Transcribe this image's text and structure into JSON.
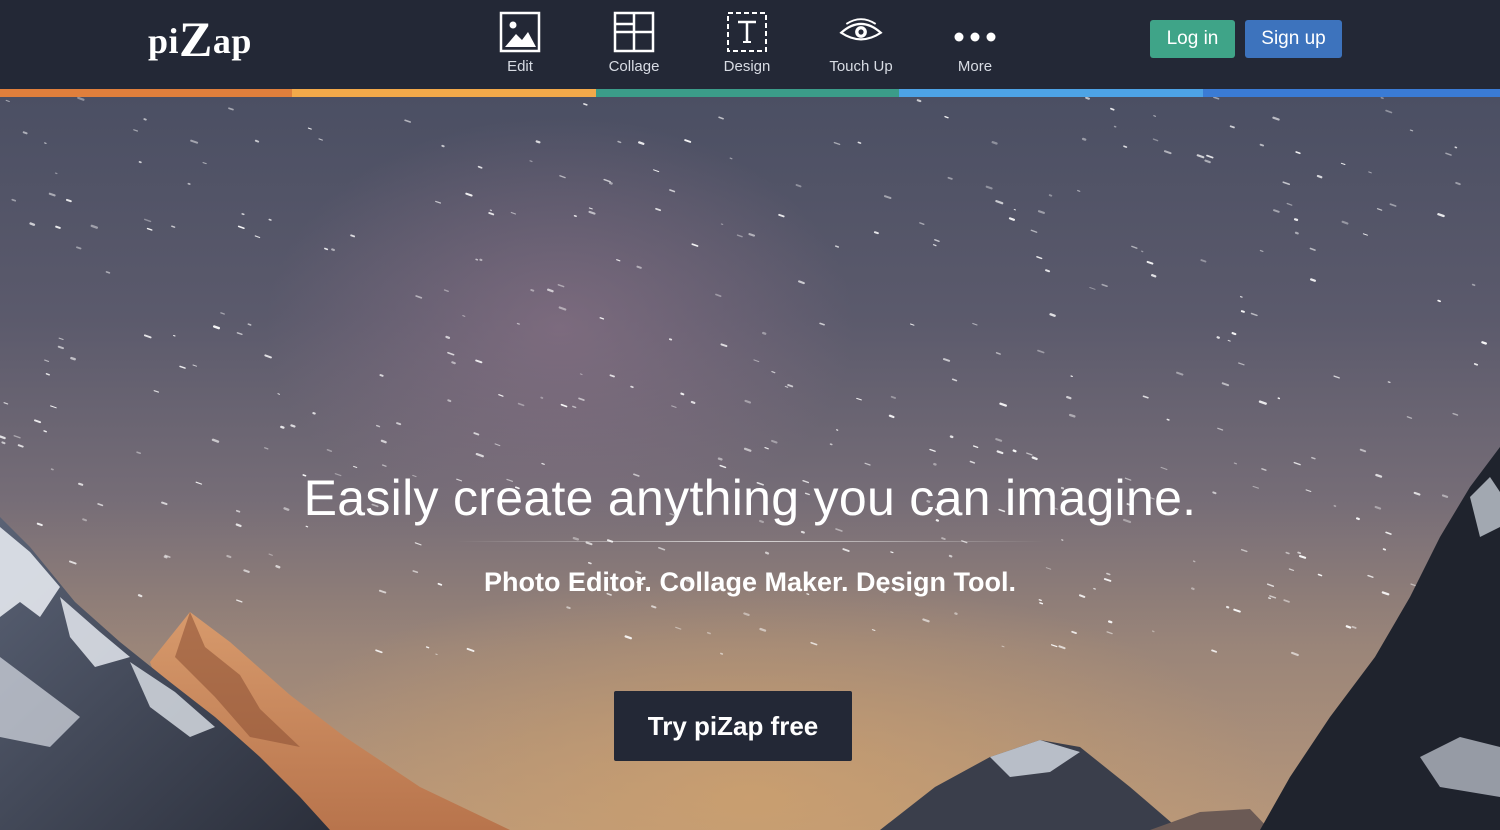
{
  "header": {
    "logo": {
      "prefix": "pi",
      "z": "Z",
      "suffix": "ap"
    },
    "nav": [
      {
        "label": "Edit",
        "icon": "image-icon"
      },
      {
        "label": "Collage",
        "icon": "collage-grid-icon"
      },
      {
        "label": "Design",
        "icon": "text-frame-icon"
      },
      {
        "label": "Touch Up",
        "icon": "eye-icon"
      },
      {
        "label": "More",
        "icon": "more-dots-icon"
      }
    ],
    "login_label": "Log in",
    "signup_label": "Sign up"
  },
  "colors": {
    "header_bg": "#232836",
    "login": "#3fa488",
    "signup": "#3d73bd",
    "strip": [
      "#e07f3c",
      "#f2a94a",
      "#3b9c89",
      "#4da3e6",
      "#3a7bd5"
    ]
  },
  "hero": {
    "title": "Easily create anything you can imagine.",
    "subtitle": "Photo Editor. Collage Maker. Design Tool.",
    "cta_label": "Try piZap free"
  }
}
